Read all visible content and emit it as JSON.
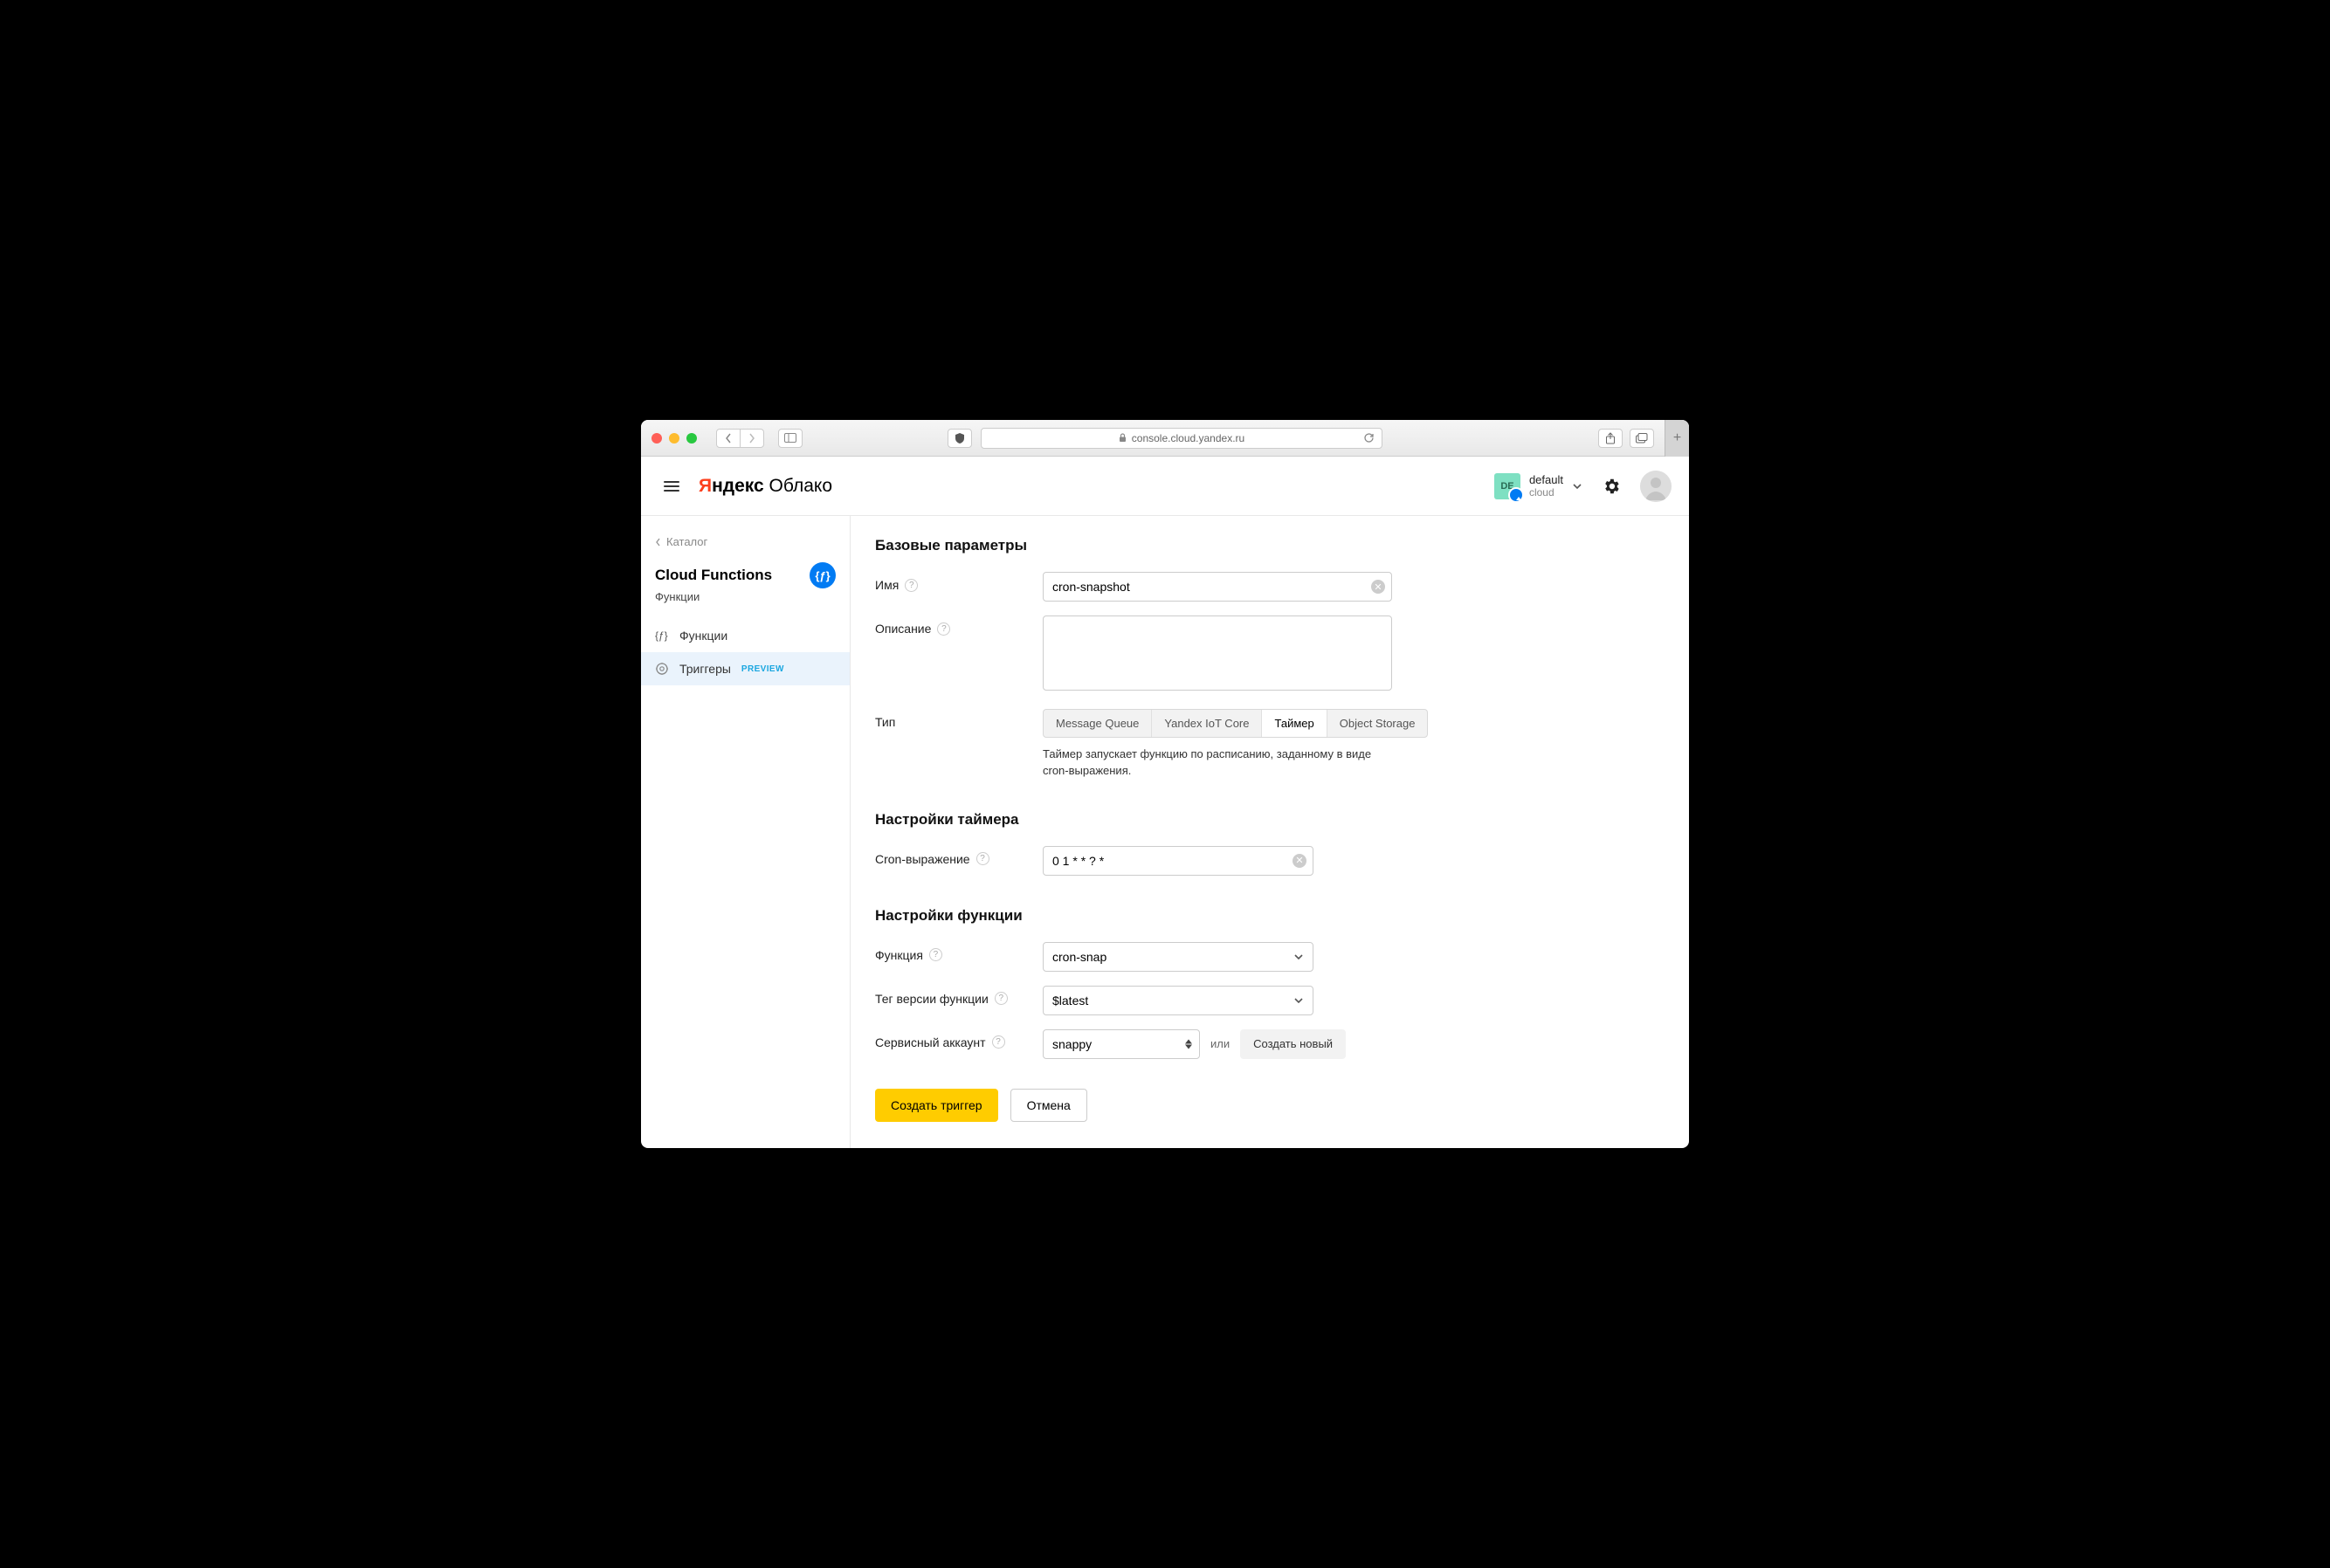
{
  "browser": {
    "url": "console.cloud.yandex.ru"
  },
  "logo": {
    "y": "Я",
    "andex": "ндекс",
    "cloud": " Облако"
  },
  "header": {
    "org_badge": "DE",
    "org_name": "default",
    "org_sub": "cloud"
  },
  "sidebar": {
    "crumb": "Каталог",
    "service_title": "Cloud Functions",
    "service_sub": "Функции",
    "items": [
      {
        "label": "Функции"
      },
      {
        "label": "Триггеры",
        "badge": "PREVIEW"
      }
    ]
  },
  "sections": {
    "basic": "Базовые параметры",
    "timer": "Настройки таймера",
    "func": "Настройки функции"
  },
  "form": {
    "name_label": "Имя",
    "name_value": "cron-snapshot",
    "desc_label": "Описание",
    "desc_value": "",
    "type_label": "Тип",
    "type_hint": "Таймер запускает функцию по расписанию, заданному в виде cron-выражения.",
    "cron_label": "Cron-выражение",
    "cron_value": "0 1 * * ? *",
    "function_label": "Функция",
    "function_value": "cron-snap",
    "tag_label": "Тег версии функции",
    "tag_value": "$latest",
    "sa_label": "Сервисный аккаунт",
    "sa_value": "snappy",
    "sa_or": "или",
    "sa_create": "Создать новый"
  },
  "type_tabs": {
    "mq": "Message Queue",
    "iot": "Yandex IoT Core",
    "timer": "Таймер",
    "os": "Object Storage"
  },
  "actions": {
    "submit": "Создать триггер",
    "cancel": "Отмена"
  }
}
